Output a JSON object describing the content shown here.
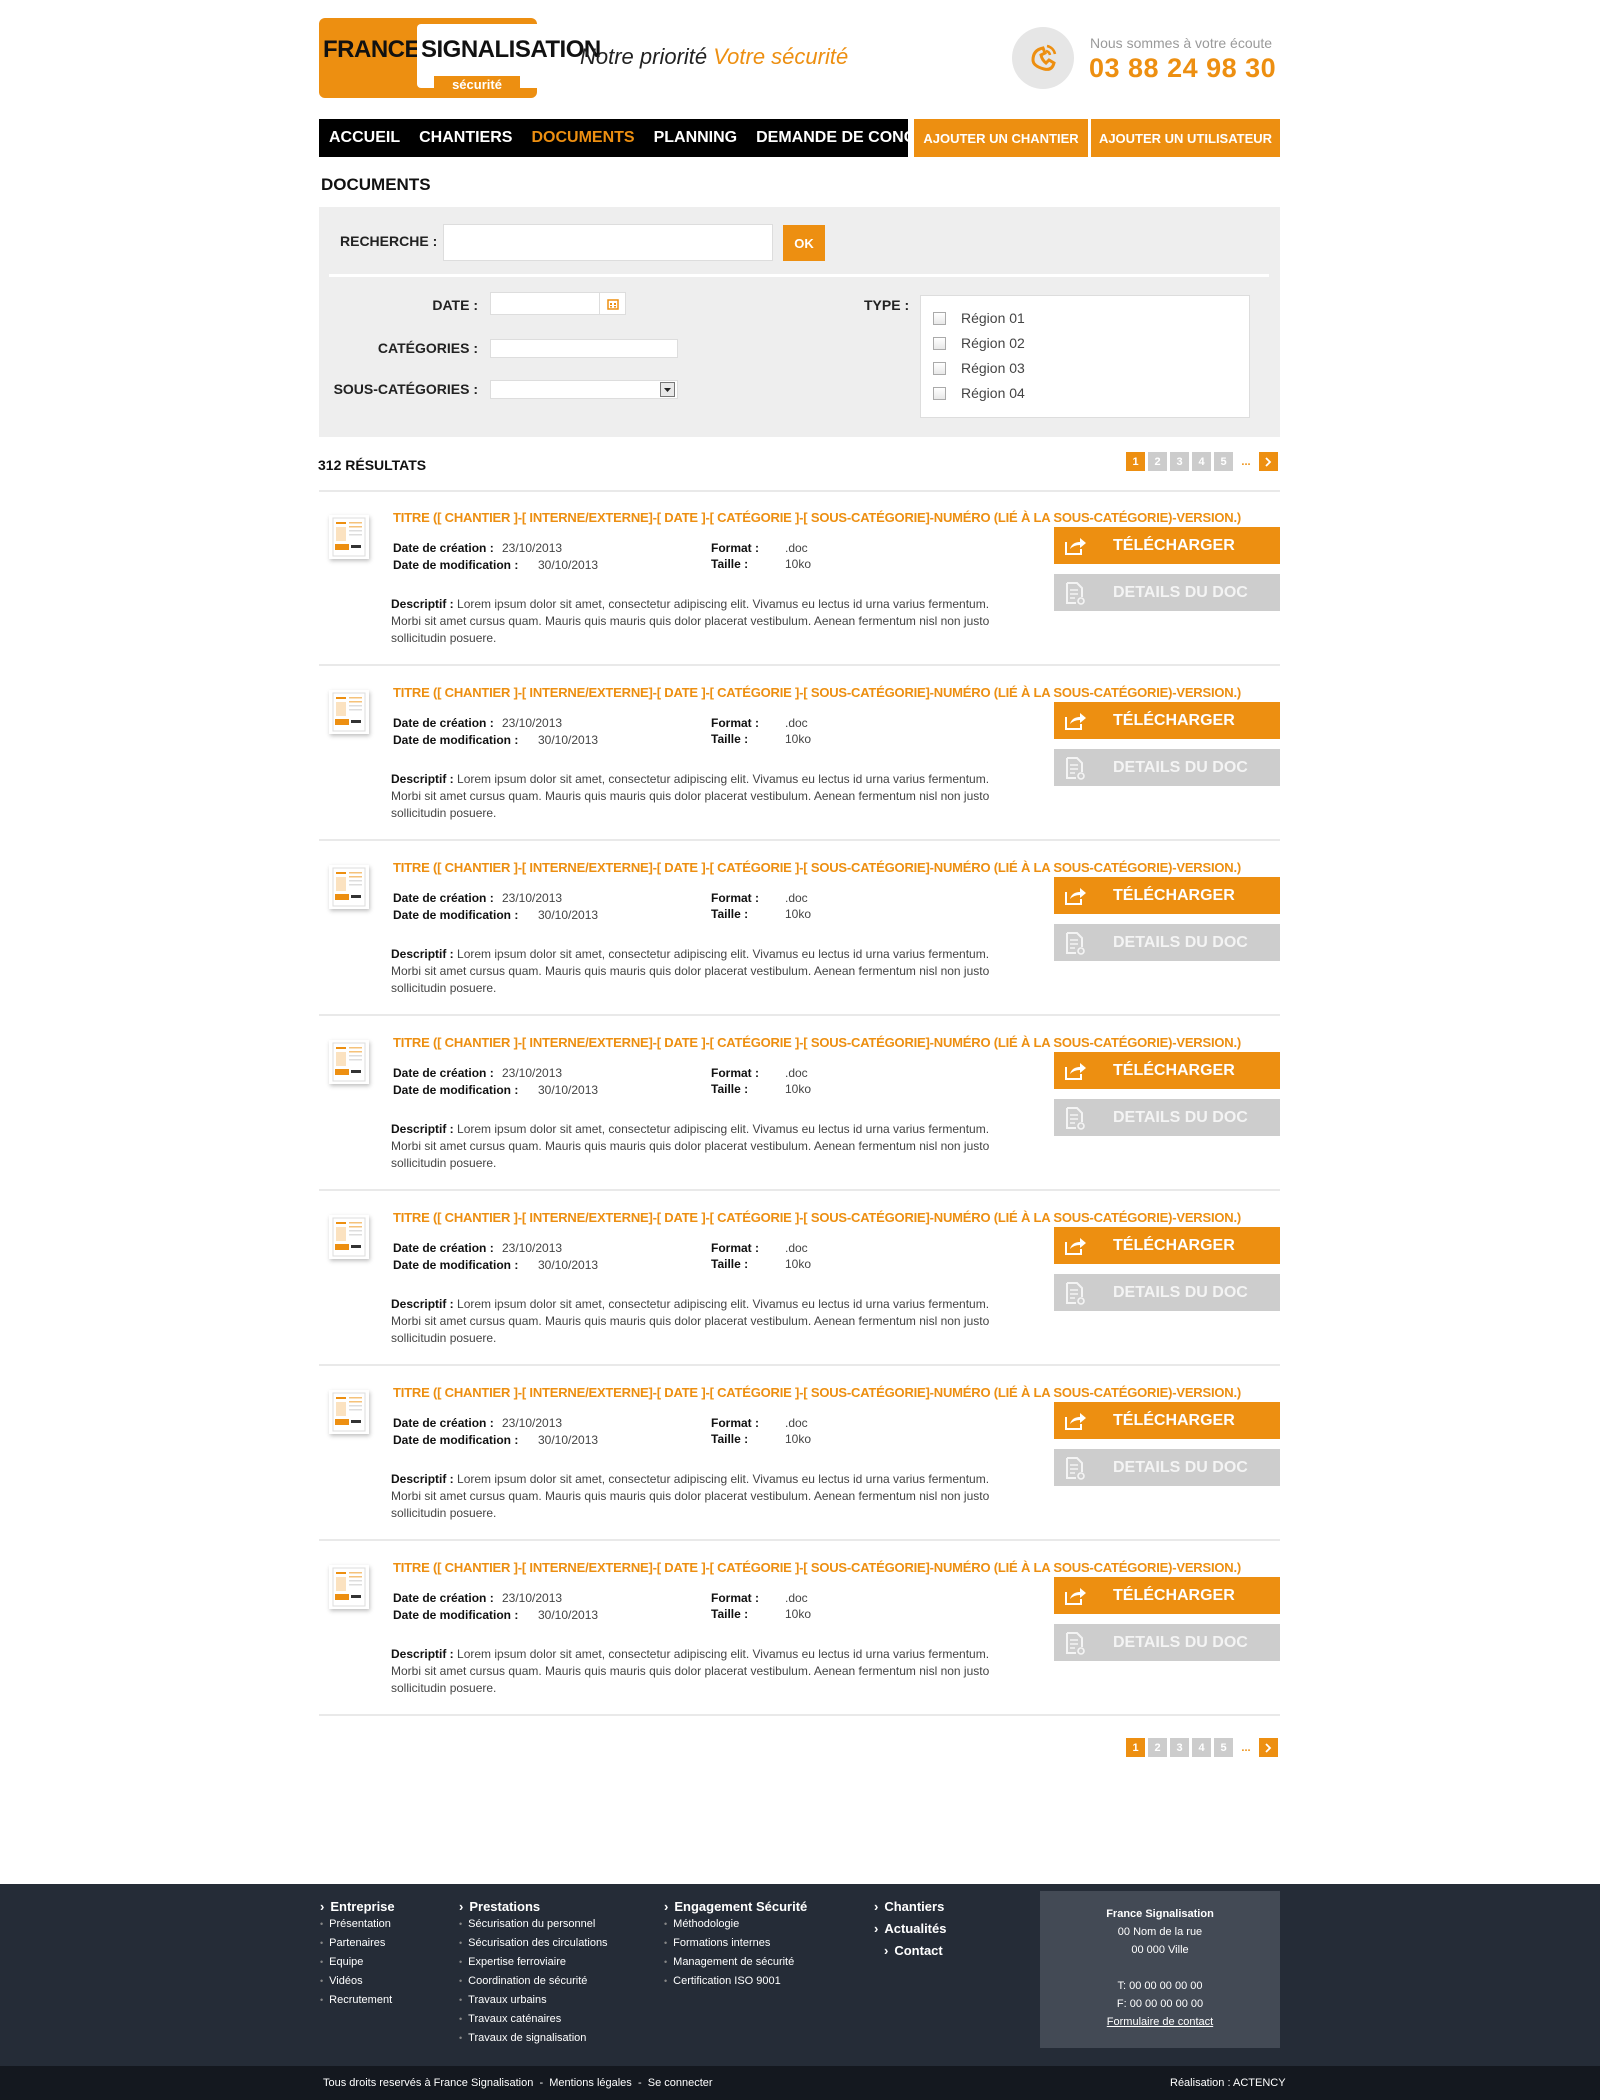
{
  "header": {
    "logo_line1": "FRANCE",
    "logo_line2": "SIGNALISATION",
    "logo_sub": "sécurité",
    "tagline_part1": "Notre priorité",
    "tagline_part2": "Votre sécurité",
    "listen_text": "Nous sommes à votre écoute",
    "phone": "03 88 24 98 30"
  },
  "nav": {
    "items": [
      "ACCUEIL",
      "CHANTIERS",
      "DOCUMENTS",
      "PLANNING",
      "DEMANDE DE CONGÉ"
    ],
    "active": "DOCUMENTS",
    "add_chantier": "AJOUTER UN CHANTIER",
    "add_user": "AJOUTER UN UTILISATEUR"
  },
  "page_title": "DOCUMENTS",
  "search": {
    "label": "RECHERCHE :",
    "value": "",
    "ok": "OK",
    "date_label": "DATE :",
    "date_value": "",
    "categories_label": "CATÉGORIES :",
    "categories_value": "",
    "subcategories_label": "SOUS-CATÉGORIES :",
    "subcategories_value": "",
    "type_label": "TYPE :",
    "types": [
      "Région 01",
      "Région 02",
      "Région 03",
      "Région 04"
    ]
  },
  "results": {
    "count": "312 RÉSULTATS",
    "pages": [
      "1",
      "2",
      "3",
      "4",
      "5"
    ],
    "current_page": "1",
    "ellipsis": "..."
  },
  "doc_labels": {
    "created": "Date de création :",
    "modified": "Date de modification :",
    "format": "Format :",
    "size": "Taille :",
    "desc": "Descriptif :",
    "download": "TÉLÉCHARGER",
    "details": "DETAILS DU DOC"
  },
  "documents": [
    {
      "title": "TITRE ([ CHANTIER ]-[ INTERNE/EXTERNE]-[ DATE ]-[ CATÉGORIE ]-[ SOUS-CATÉGORIE]-NUMÉRO (LIÉ À LA SOUS-CATÉGORIE)-VERSION.)",
      "created": "23/10/2013",
      "modified": "30/10/2013",
      "format": ".doc",
      "size": "10ko",
      "desc": "Lorem ipsum dolor sit amet, consectetur adipiscing elit. Vivamus eu lectus id urna varius fermentum. Morbi sit amet cursus quam. Mauris quis mauris quis dolor placerat vestibulum. Aenean fermentum nisl non justo sollicitudin posuere."
    },
    {
      "title": "TITRE ([ CHANTIER ]-[ INTERNE/EXTERNE]-[ DATE ]-[ CATÉGORIE ]-[ SOUS-CATÉGORIE]-NUMÉRO (LIÉ À LA SOUS-CATÉGORIE)-VERSION.)",
      "created": "23/10/2013",
      "modified": "30/10/2013",
      "format": ".doc",
      "size": "10ko",
      "desc": "Lorem ipsum dolor sit amet, consectetur adipiscing elit. Vivamus eu lectus id urna varius fermentum. Morbi sit amet cursus quam. Mauris quis mauris quis dolor placerat vestibulum. Aenean fermentum nisl non justo sollicitudin posuere."
    },
    {
      "title": "TITRE ([ CHANTIER ]-[ INTERNE/EXTERNE]-[ DATE ]-[ CATÉGORIE ]-[ SOUS-CATÉGORIE]-NUMÉRO (LIÉ À LA SOUS-CATÉGORIE)-VERSION.)",
      "created": "23/10/2013",
      "modified": "30/10/2013",
      "format": ".doc",
      "size": "10ko",
      "desc": "Lorem ipsum dolor sit amet, consectetur adipiscing elit. Vivamus eu lectus id urna varius fermentum. Morbi sit amet cursus quam. Mauris quis mauris quis dolor placerat vestibulum. Aenean fermentum nisl non justo sollicitudin posuere."
    },
    {
      "title": "TITRE ([ CHANTIER ]-[ INTERNE/EXTERNE]-[ DATE ]-[ CATÉGORIE ]-[ SOUS-CATÉGORIE]-NUMÉRO (LIÉ À LA SOUS-CATÉGORIE)-VERSION.)",
      "created": "23/10/2013",
      "modified": "30/10/2013",
      "format": ".doc",
      "size": "10ko",
      "desc": "Lorem ipsum dolor sit amet, consectetur adipiscing elit. Vivamus eu lectus id urna varius fermentum. Morbi sit amet cursus quam. Mauris quis mauris quis dolor placerat vestibulum. Aenean fermentum nisl non justo sollicitudin posuere."
    },
    {
      "title": "TITRE ([ CHANTIER ]-[ INTERNE/EXTERNE]-[ DATE ]-[ CATÉGORIE ]-[ SOUS-CATÉGORIE]-NUMÉRO (LIÉ À LA SOUS-CATÉGORIE)-VERSION.)",
      "created": "23/10/2013",
      "modified": "30/10/2013",
      "format": ".doc",
      "size": "10ko",
      "desc": "Lorem ipsum dolor sit amet, consectetur adipiscing elit. Vivamus eu lectus id urna varius fermentum. Morbi sit amet cursus quam. Mauris quis mauris quis dolor placerat vestibulum. Aenean fermentum nisl non justo sollicitudin posuere."
    },
    {
      "title": "TITRE ([ CHANTIER ]-[ INTERNE/EXTERNE]-[ DATE ]-[ CATÉGORIE ]-[ SOUS-CATÉGORIE]-NUMÉRO (LIÉ À LA SOUS-CATÉGORIE)-VERSION.)",
      "created": "23/10/2013",
      "modified": "30/10/2013",
      "format": ".doc",
      "size": "10ko",
      "desc": "Lorem ipsum dolor sit amet, consectetur adipiscing elit. Vivamus eu lectus id urna varius fermentum. Morbi sit amet cursus quam. Mauris quis mauris quis dolor placerat vestibulum. Aenean fermentum nisl non justo sollicitudin posuere."
    },
    {
      "title": "TITRE ([ CHANTIER ]-[ INTERNE/EXTERNE]-[ DATE ]-[ CATÉGORIE ]-[ SOUS-CATÉGORIE]-NUMÉRO (LIÉ À LA SOUS-CATÉGORIE)-VERSION.)",
      "created": "23/10/2013",
      "modified": "30/10/2013",
      "format": ".doc",
      "size": "10ko",
      "desc": "Lorem ipsum dolor sit amet, consectetur adipiscing elit. Vivamus eu lectus id urna varius fermentum. Morbi sit amet cursus quam. Mauris quis mauris quis dolor placerat vestibulum. Aenean fermentum nisl non justo sollicitudin posuere."
    }
  ],
  "footer": {
    "col1": {
      "title": "Entreprise",
      "items": [
        "Présentation",
        "Partenaires",
        "Equipe",
        "Vidéos",
        "Recrutement"
      ]
    },
    "col2": {
      "title": "Prestations",
      "items": [
        "Sécurisation du personnel",
        "Sécurisation des circulations",
        "Expertise ferroviaire",
        "Coordination de sécurité",
        "Travaux urbains",
        "Travaux caténaires",
        "Travaux de signalisation"
      ]
    },
    "col3": {
      "title": "Engagement Sécurité",
      "items": [
        "Méthodologie",
        "Formations internes",
        "Management de sécurité",
        "Certification ISO 9001"
      ]
    },
    "col4": {
      "items": [
        "Chantiers",
        "Actualités",
        "Contact"
      ]
    },
    "contact": {
      "name": "France Signalisation",
      "street": "00 Nom de la rue",
      "city": "00 000 Ville",
      "tel": "T: 00 00 00 00 00",
      "fax": "F: 00 00 00 00 00",
      "form_link": "Formulaire de contact"
    },
    "copyright": "Tous droits reservés à France Signalisation",
    "sep": "-",
    "legal": "Mentions légales",
    "login": "Se connecter",
    "credit": "Réalisation : ACTENCY"
  },
  "colors": {
    "accent": "#ed8f11",
    "nav_bg": "#000000",
    "footer_bg": "#252c37",
    "panel_bg": "#eeeeee"
  }
}
